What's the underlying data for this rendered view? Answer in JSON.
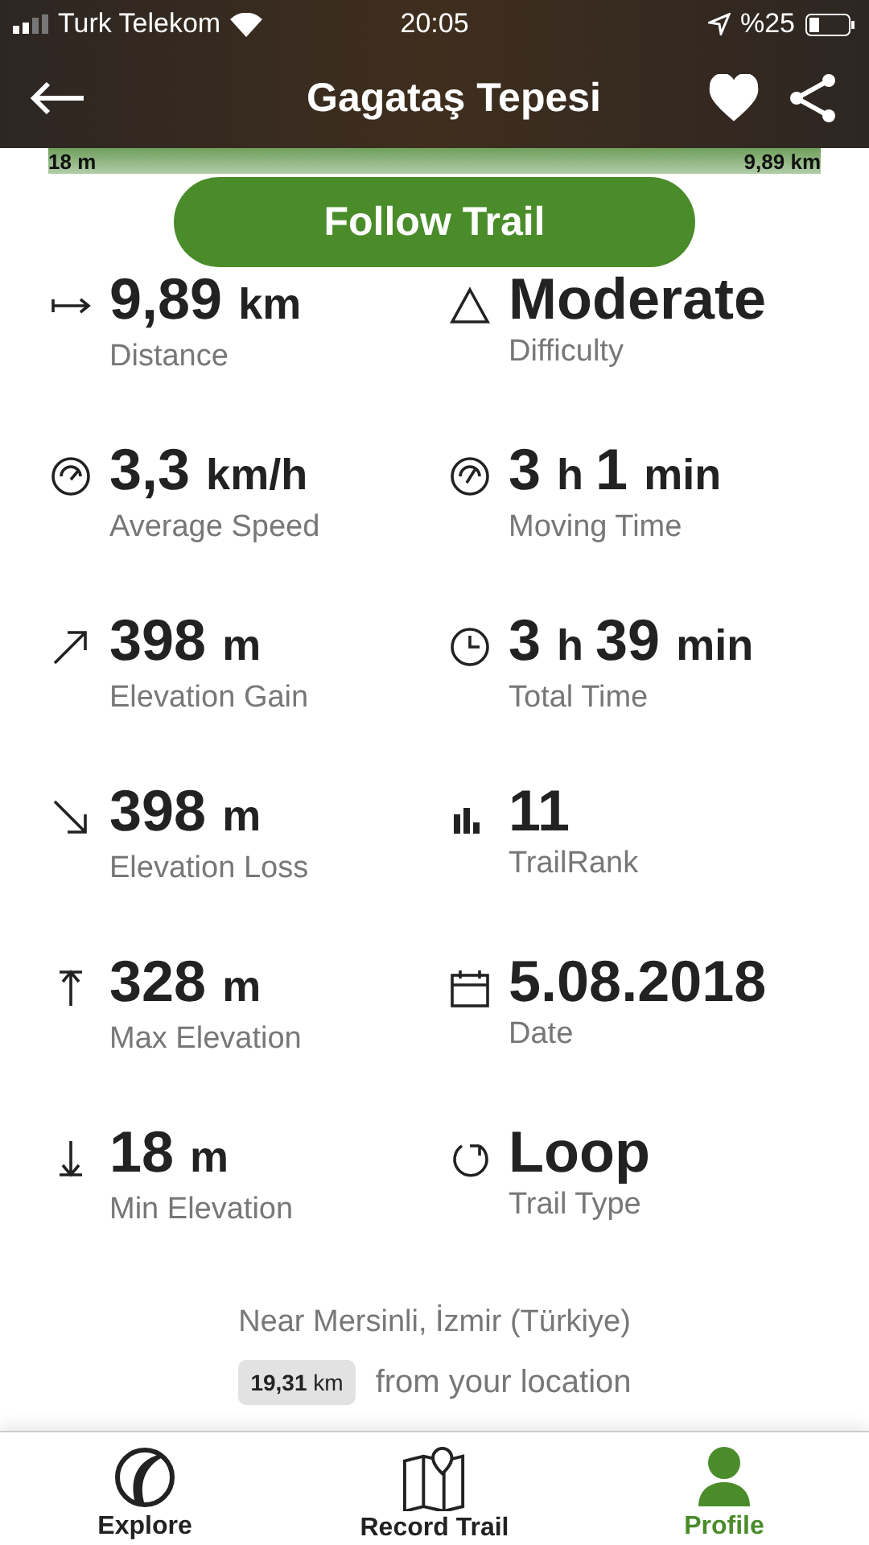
{
  "status_bar": {
    "carrier": "Turk Telekom",
    "time": "20:05",
    "battery": "%25"
  },
  "header": {
    "title": "Gagataş Tepesi",
    "favorite": true
  },
  "elevation_strip": {
    "start": "18 m",
    "end": "9,89 km"
  },
  "follow_button": "Follow Trail",
  "stats": [
    {
      "kind": "distance",
      "value": "9,89 km",
      "label": "Distance"
    },
    {
      "kind": "difficulty",
      "value": "Moderate",
      "label": "Difficulty"
    },
    {
      "kind": "speed",
      "value": "3,3 km/h",
      "label": "Average Speed"
    },
    {
      "kind": "moving",
      "value": "3 h 1 min",
      "label": "Moving Time"
    },
    {
      "kind": "gain",
      "value": "398 m",
      "label": "Elevation Gain"
    },
    {
      "kind": "clock",
      "value": "3 h 39 min",
      "label": "Total Time"
    },
    {
      "kind": "loss",
      "value": "398 m",
      "label": "Elevation Loss"
    },
    {
      "kind": "rank",
      "value": "11",
      "label": "TrailRank"
    },
    {
      "kind": "max",
      "value": "328 m",
      "label": "Max Elevation"
    },
    {
      "kind": "date",
      "value": "5.08.2018",
      "label": "Date"
    },
    {
      "kind": "min",
      "value": "18 m",
      "label": "Min Elevation"
    },
    {
      "kind": "loop",
      "value": "Loop",
      "label": "Trail Type"
    }
  ],
  "location": {
    "place": "Near Mersinli, İzmir (Türkiye)",
    "distance_number": "19,31",
    "distance_unit": "km",
    "suffix": "from your location"
  },
  "tabs": [
    {
      "kind": "explore",
      "label": "Explore",
      "selected": false
    },
    {
      "kind": "record",
      "label": "Record Trail",
      "selected": false
    },
    {
      "kind": "profile",
      "label": "Profile",
      "selected": true
    }
  ]
}
